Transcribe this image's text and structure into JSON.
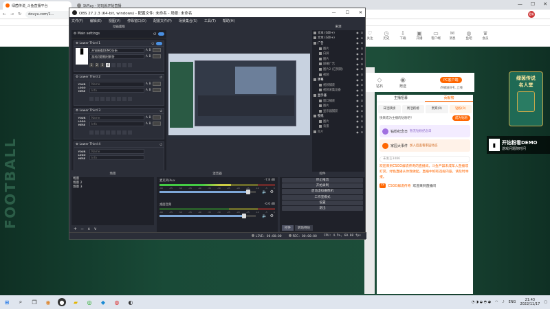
{
  "browser": {
    "tabs": [
      {
        "label": "绿茵传说_斗鱼直播平台",
        "active": true
      },
      {
        "label": "StPlay - 好玩就开始直播",
        "active": false
      }
    ],
    "url": "douyu.com/1...",
    "profile_badge": "更新"
  },
  "site": {
    "header_icons": [
      {
        "label": "关注"
      },
      {
        "label": "历史"
      },
      {
        "label": "下载"
      },
      {
        "label": "开播"
      },
      {
        "label": "客户端"
      },
      {
        "label": "消息"
      },
      {
        "label": "鱼吧"
      },
      {
        "label": "会员"
      }
    ],
    "side_word": "FOOTBALL",
    "gifts": [
      {
        "label": "钻石"
      },
      {
        "label": "赠送"
      }
    ],
    "pc_client_button": "PC客户端",
    "pc_client_sub": "点播送好礼 上线",
    "right_panel": {
      "tabs": [
        {
          "label": "主播招募",
          "active": false
        },
        {
          "label": "贡献榜",
          "active": true
        }
      ],
      "subtabs": [
        {
          "label": "日活跃榜",
          "active": false
        },
        {
          "label": "周活跃榜",
          "active": false
        },
        {
          "label": "贵宾(0)",
          "active": false
        },
        {
          "label": "钻粉(0)",
          "active": true
        }
      ],
      "fan_prompt": "快来成为主播的钻粉吧！",
      "join_button": "成为钻粉",
      "cards": [
        {
          "title": "钻粉纪念日",
          "sub": "暂无钻粉纪念日",
          "style": "purple"
        },
        {
          "title": "家园大事件",
          "sub": "加入后查看家园动态",
          "style": "orange"
        }
      ],
      "input_placeholder": "未发言3486",
      "notice": "欢迎来到CSGO解说传奇的直播间。斗鱼严禁未成年人直播或打赏，绿色直播从你我做起。直播中如有违规内容，请及时举报。",
      "chat_level": "LV",
      "chat_user": "CSGO解说传奇",
      "chat_text": "欢迎来到直播间"
    },
    "promo": {
      "title": "绿茵传说",
      "subtitle": "名人堂"
    },
    "overlay": {
      "logo": "▮",
      "title": "开钻粉看DEMO",
      "subtitle": "游戏问题随时问"
    }
  },
  "obs": {
    "title": "OBS 27.2.3 (64-bit, windows) - 配置文件: 未命名 - 场景: 未命名",
    "menu": [
      "文件(F)",
      "编辑(E)",
      "视图(V)",
      "停靠窗口(D)",
      "配置文件(P)",
      "场景集合(S)",
      "工具(T)",
      "帮助(H)"
    ],
    "lower_third_dock": {
      "title": "动画面板",
      "main_settings": "Main settings",
      "blocks": [
        {
          "name": "Lower Third 1",
          "line1": "开钻粉看DEMO分析",
          "line2": "游戏问题随时解答",
          "logo": "▮",
          "has_logo_image": true
        },
        {
          "name": "Lower Third 2",
          "line1": "Name",
          "line2": "Info",
          "logo": "YOUR LOGO HERE",
          "has_logo_image": false
        },
        {
          "name": "Lower Third 3",
          "line1": "Name",
          "line2": "Info",
          "logo": "YOUR LOGO HERE",
          "has_logo_image": false
        },
        {
          "name": "Lower Third 4",
          "line1": "Name",
          "line2": "Info",
          "logo": "YOUR LOGO HERE",
          "has_logo_image": false
        }
      ],
      "slot_numbers": [
        "1",
        "2",
        "3",
        "4"
      ]
    },
    "preview": {
      "no_scene_label": "未选择场景"
    },
    "sources": {
      "title": "来源",
      "items": [
        {
          "label": "文本 (GDI+)",
          "type": "item"
        },
        {
          "label": "文本 (GDI+)",
          "type": "item"
        },
        {
          "label": "广告",
          "type": "group"
        },
        {
          "label": "图片",
          "type": "child"
        },
        {
          "label": "白屏",
          "type": "child"
        },
        {
          "label": "图片",
          "type": "child"
        },
        {
          "label": "屏幕广告",
          "type": "child"
        },
        {
          "label": "图片2 (已到期)",
          "type": "child"
        },
        {
          "label": "视频",
          "type": "child"
        },
        {
          "label": "弹幕",
          "type": "group"
        },
        {
          "label": "视频捕获",
          "type": "child"
        },
        {
          "label": "视频采集设备",
          "type": "child"
        },
        {
          "label": "显示器",
          "type": "group"
        },
        {
          "label": "窗口捕获",
          "type": "child"
        },
        {
          "label": "图片",
          "type": "child"
        },
        {
          "label": "显示器捕获",
          "type": "child"
        },
        {
          "label": "壁纸",
          "type": "group"
        },
        {
          "label": "图片",
          "type": "child"
        },
        {
          "label": "背景",
          "type": "child"
        },
        {
          "label": "图片",
          "type": "dim"
        }
      ]
    },
    "scenes": {
      "title": "场景",
      "items": [
        "场景",
        "场景 2",
        "场景 3"
      ]
    },
    "mixer": {
      "title": "混音器",
      "channels": [
        {
          "name": "麦克风/Aux",
          "db": "-7.8 dB",
          "level": 0.62,
          "volume": 0.92
        },
        {
          "name": "桌面音频",
          "db": "-0.0 dB",
          "level": 0.0,
          "volume": 0.88
        }
      ],
      "ticks": [
        "-60",
        "-55",
        "-50",
        "-45",
        "-40",
        "-35",
        "-30",
        "-25",
        "-20",
        "-15",
        "-10",
        "-5",
        "0"
      ]
    },
    "controls": {
      "title": "控件",
      "buttons": [
        "停止推流",
        "开始录制",
        "启动虚拟摄像机",
        "工作室模式",
        "设置",
        "退出"
      ],
      "tabs": [
        {
          "label": "控件",
          "active": true
        },
        {
          "label": "转场特效",
          "active": false
        }
      ]
    },
    "status": {
      "live": "LIVE: 00:00:00",
      "rec": "REC: 00:00:00",
      "cpu": "CPU: 4.5%, 60.00 fps"
    }
  },
  "taskbar": {
    "lang": "ENG",
    "time": "21:43",
    "date": "2022/11/17"
  }
}
